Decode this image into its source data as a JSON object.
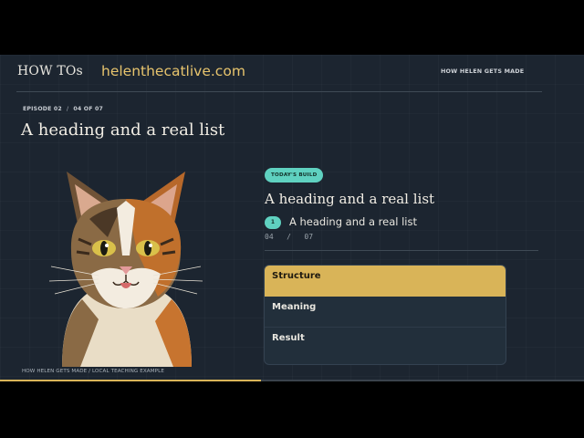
{
  "header": {
    "brand": "HOW TOs",
    "site": "helenthecatlive.com",
    "nav_label": "HOW HELEN GETS MADE"
  },
  "episode": {
    "label": "EPISODE 02",
    "separator": "/",
    "progress": "04 OF 07"
  },
  "page_title": "A heading and a real list",
  "image": {
    "caption": "HOW HELEN GETS MADE / LOCAL TEACHING EXAMPLE"
  },
  "build": {
    "badge": "TODAY'S BUILD",
    "title": "A heading and a real list",
    "step_number": "1",
    "step_label": "A heading and a real list",
    "counter_current": "04",
    "counter_sep": "/",
    "counter_total": "07"
  },
  "accordion": [
    {
      "label": "Structure",
      "active": true
    },
    {
      "label": "Meaning",
      "active": false
    },
    {
      "label": "Result",
      "active": false
    }
  ],
  "video_progress": 0.447,
  "colors": {
    "accent_gold": "#d9b458",
    "accent_teal": "#5fd1c0",
    "site_gold": "#e7c46d",
    "background": "#1c2530"
  }
}
